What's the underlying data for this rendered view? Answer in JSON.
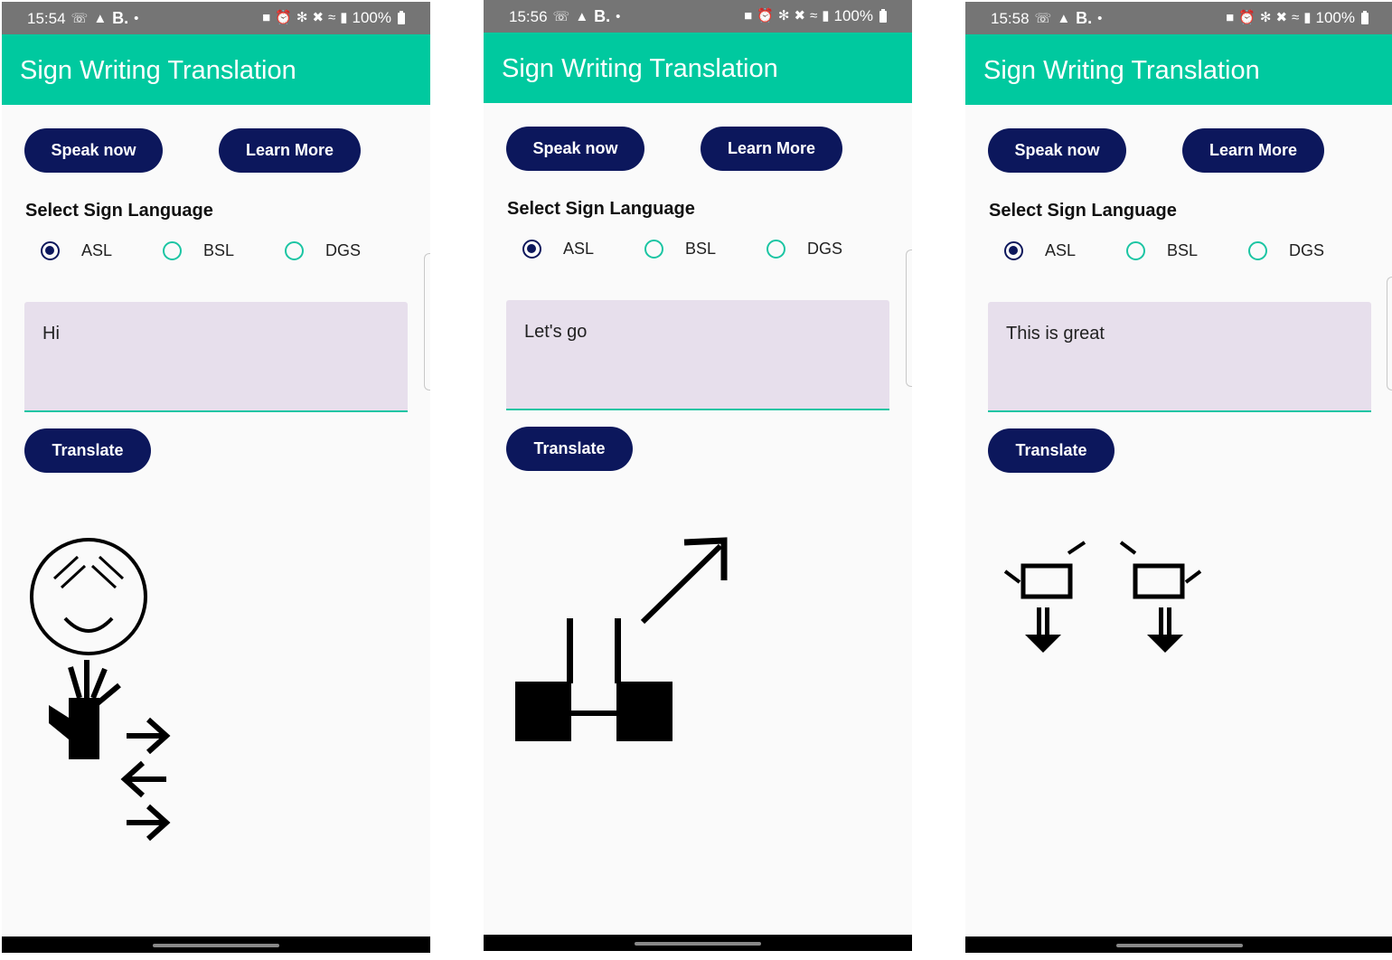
{
  "screens": [
    {
      "status": {
        "time": "15:54",
        "carrier_letter": "B.",
        "battery": "100%"
      },
      "app_title": "Sign Writing Translation",
      "speak_label": "Speak now",
      "learn_label": "Learn More",
      "select_label": "Select Sign Language",
      "options": [
        "ASL",
        "BSL",
        "DGS"
      ],
      "selected": "ASL",
      "input_text": "Hi",
      "translate_label": "Translate",
      "sign_icon": "signwriting-hi-icon"
    },
    {
      "status": {
        "time": "15:56",
        "carrier_letter": "B.",
        "battery": "100%"
      },
      "app_title": "Sign Writing Translation",
      "speak_label": "Speak now",
      "learn_label": "Learn More",
      "select_label": "Select Sign Language",
      "options": [
        "ASL",
        "BSL",
        "DGS"
      ],
      "selected": "ASL",
      "input_text": "Let's go",
      "translate_label": "Translate",
      "sign_icon": "signwriting-lets-go-icon"
    },
    {
      "status": {
        "time": "15:58",
        "carrier_letter": "B.",
        "battery": "100%"
      },
      "app_title": "Sign Writing Translation",
      "speak_label": "Speak now",
      "learn_label": "Learn More",
      "select_label": "Select Sign Language",
      "options": [
        "ASL",
        "BSL",
        "DGS"
      ],
      "selected": "ASL",
      "input_text": "This is great",
      "translate_label": "Translate",
      "sign_icon": "signwriting-this-is-great-icon"
    }
  ],
  "colors": {
    "app_bar": "#00c99f",
    "button": "#0c175c",
    "status_bar": "#757575",
    "text_field": "#e7dfec",
    "radio_accent": "#1bc5a3"
  }
}
